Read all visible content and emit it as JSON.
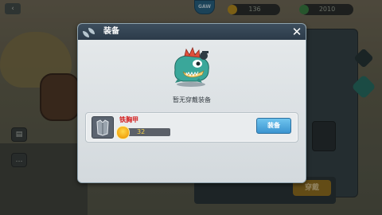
{
  "hud": {
    "badge_text": "GAW",
    "coins": "136",
    "gems": "2010",
    "bottom_button": "穿戴"
  },
  "dialog": {
    "title": "装备",
    "close_symbol": "✕",
    "empty_message": "暂无穿戴装备",
    "items": [
      {
        "name": "铁胸甲",
        "stat_value": "32",
        "action_label": "装备"
      }
    ]
  },
  "colors": {
    "item_name": "#d42020",
    "equip_button": "#3b94d0",
    "header": "#2c3b49",
    "pet_body": "#3aa79a"
  }
}
